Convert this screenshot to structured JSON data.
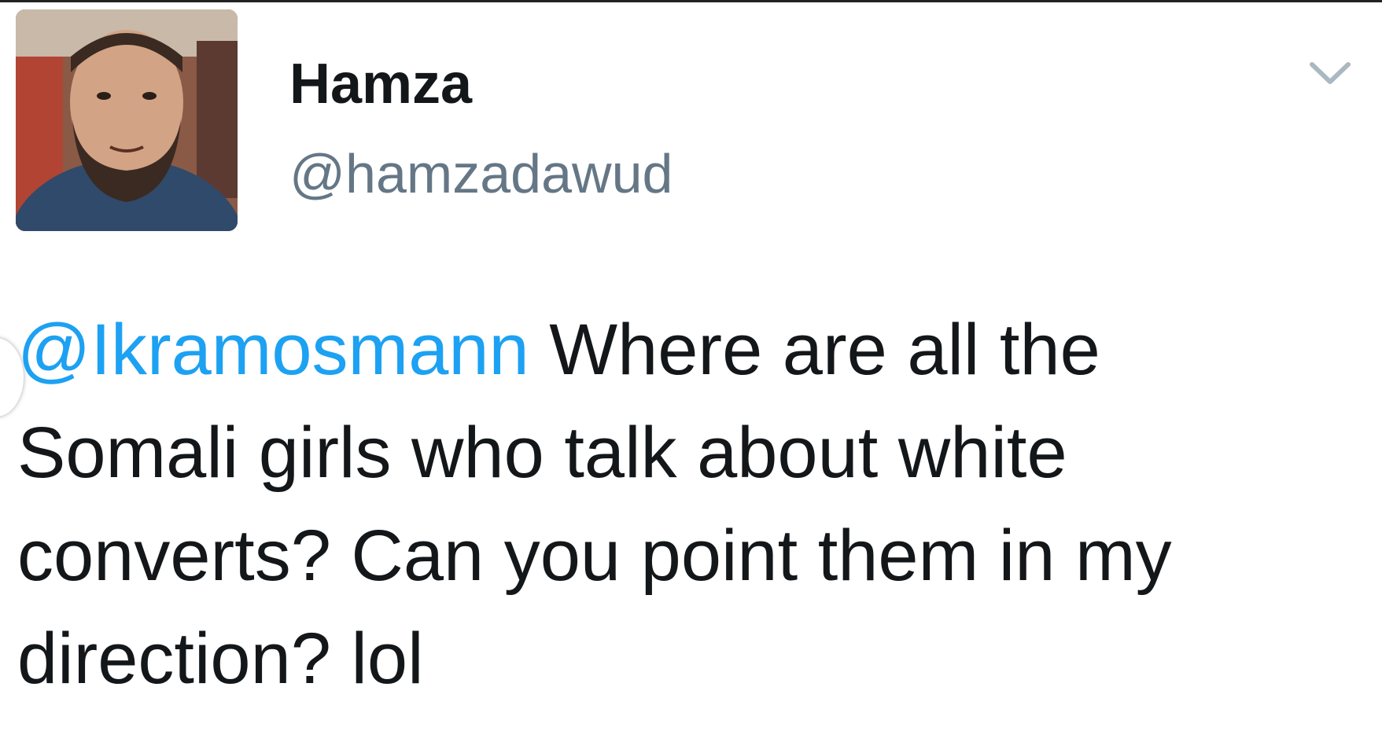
{
  "author": {
    "display_name": "Hamza",
    "handle": "@hamzadawud",
    "avatar_icon": "profile-photo"
  },
  "menu": {
    "icon": "chevron-down-icon"
  },
  "tweet": {
    "mention": "@Ikramosmann",
    "line1_rest": " Where are all the",
    "line2": "Somali girls who talk about white",
    "line3": "converts? Can you point them in my",
    "line4": "direction? lol"
  },
  "colors": {
    "mention": "#1da1f2",
    "text": "#14171a",
    "handle": "#657786"
  }
}
